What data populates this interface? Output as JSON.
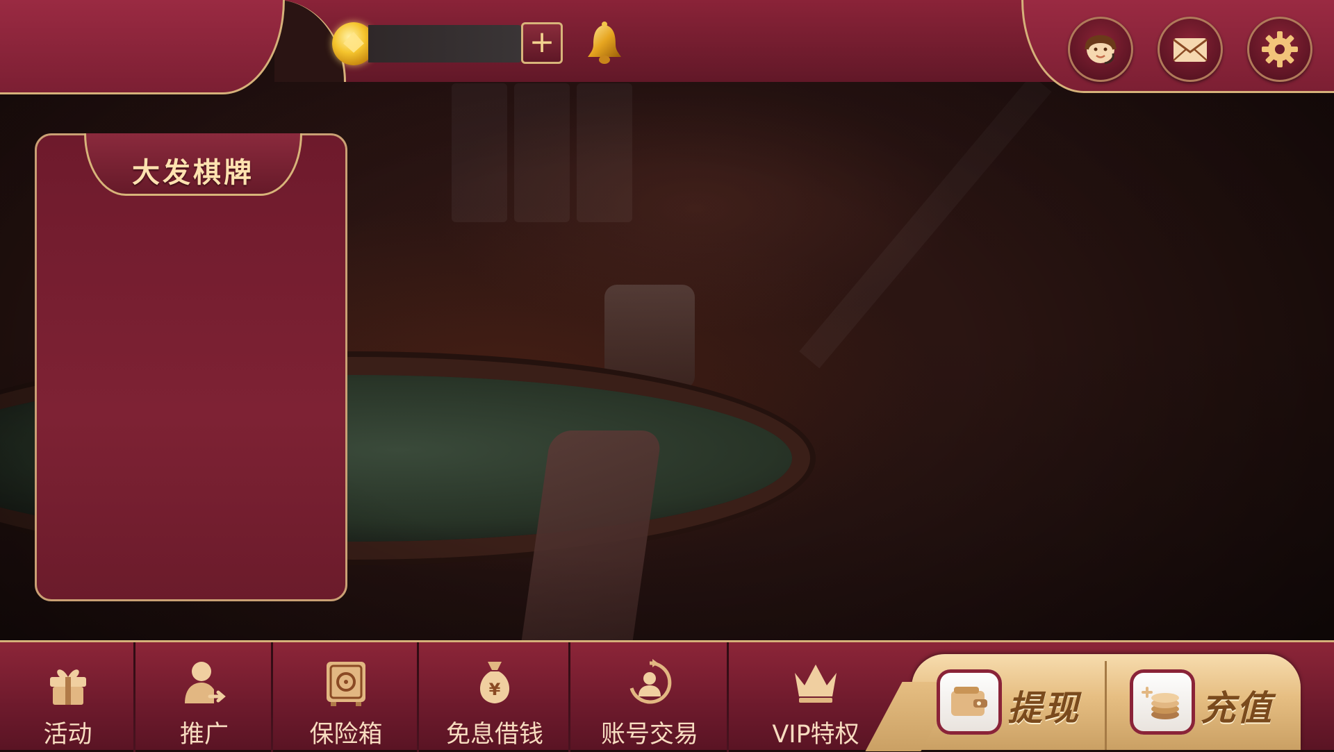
{
  "topbar": {
    "balance": "",
    "add_label": "+",
    "icons": [
      "coin-icon",
      "bell-icon",
      "customer-service-icon",
      "mail-icon",
      "settings-icon"
    ]
  },
  "side_panel": {
    "title": "大发棋牌"
  },
  "bottom_nav": {
    "items": [
      {
        "label": "活动",
        "icon": "gift-icon"
      },
      {
        "label": "推广",
        "icon": "share-user-icon"
      },
      {
        "label": "保险箱",
        "icon": "safe-icon"
      },
      {
        "label": "免息借钱",
        "icon": "money-bag-icon"
      },
      {
        "label": "账号交易",
        "icon": "account-trade-icon"
      },
      {
        "label": "VIP特权",
        "icon": "crown-icon"
      }
    ]
  },
  "cash": {
    "withdraw_label": "提现",
    "recharge_label": "充值"
  },
  "colors": {
    "primary": "#7c1f33",
    "gold": "#d6b17a",
    "label": "#f7dcc0"
  }
}
